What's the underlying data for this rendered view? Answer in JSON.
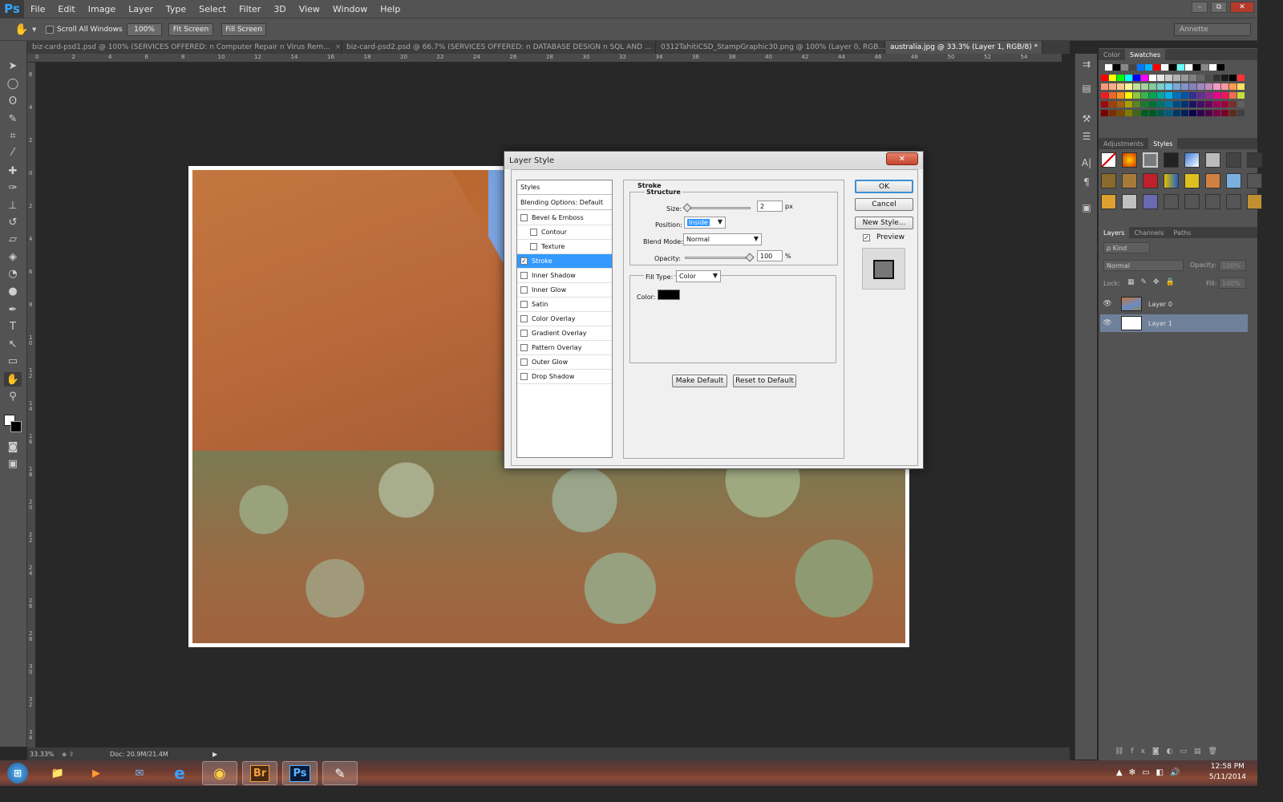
{
  "app": {
    "logo": "Ps",
    "menu": [
      "File",
      "Edit",
      "Image",
      "Layer",
      "Type",
      "Select",
      "Filter",
      "3D",
      "View",
      "Window",
      "Help"
    ],
    "window_controls": [
      "–",
      "⧉",
      "✕"
    ]
  },
  "options_bar": {
    "scroll_all_windows": "Scroll All Windows",
    "zoom100": "100%",
    "fit_screen": "Fit Screen",
    "fill_screen": "Fill Screen",
    "workspace": "Annette"
  },
  "tabs": [
    {
      "label": "biz-card-psd1.psd @ 100% (SERVICES OFFERED: n    Computer Repair    n Virus Rem..."
    },
    {
      "label": "biz-card-psd2.psd @ 66.7% (SERVICES OFFERED: n    DATABASE DESIGN n SQL AND ..."
    },
    {
      "label": "0312TahitiCSD_StampGraphic30.png @ 100% (Layer 0, RGB..."
    },
    {
      "label": "australia.jpg @ 33.3% (Layer 1, RGB/8) *"
    }
  ],
  "ruler": {
    "h_ticks": [
      "0",
      "2",
      "4",
      "6",
      "8",
      "10",
      "12",
      "14",
      "16",
      "18",
      "20",
      "22",
      "24",
      "26",
      "28",
      "30",
      "32",
      "34",
      "36",
      "38",
      "40",
      "42",
      "44",
      "46",
      "48",
      "50",
      "52",
      "54"
    ],
    "v_ticks": [
      "6",
      "4",
      "2",
      "0",
      "2",
      "4",
      "6",
      "8",
      "1 0",
      "1 2",
      "1 4",
      "1 6",
      "1 8",
      "2 0",
      "2 2",
      "2 4",
      "2 6",
      "2 8",
      "3 0",
      "3 2",
      "3 4",
      "3 6"
    ]
  },
  "status": {
    "zoom": "33.33%",
    "doc": "Doc: 20.9M/21.4M"
  },
  "dialog": {
    "title": "Layer Style",
    "close": "✕",
    "styles_header": "Styles",
    "blending": "Blending Options: Default",
    "items": [
      {
        "label": "Bevel & Emboss",
        "checked": false,
        "indent": false
      },
      {
        "label": "Contour",
        "checked": false,
        "indent": true
      },
      {
        "label": "Texture",
        "checked": false,
        "indent": true
      },
      {
        "label": "Stroke",
        "checked": true,
        "indent": false
      },
      {
        "label": "Inner Shadow",
        "checked": false,
        "indent": false
      },
      {
        "label": "Inner Glow",
        "checked": false,
        "indent": false
      },
      {
        "label": "Satin",
        "checked": false,
        "indent": false
      },
      {
        "label": "Color Overlay",
        "checked": false,
        "indent": false
      },
      {
        "label": "Gradient Overlay",
        "checked": false,
        "indent": false
      },
      {
        "label": "Pattern Overlay",
        "checked": false,
        "indent": false
      },
      {
        "label": "Outer Glow",
        "checked": false,
        "indent": false
      },
      {
        "label": "Drop Shadow",
        "checked": false,
        "indent": false
      }
    ],
    "stroke_title": "Stroke",
    "structure_title": "Structure",
    "size_label": "Size:",
    "size_value": "2",
    "size_unit": "px",
    "position_label": "Position:",
    "position_value": "Inside",
    "blend_label": "Blend Mode:",
    "blend_value": "Normal",
    "opacity_label": "Opacity:",
    "opacity_value": "100",
    "opacity_unit": "%",
    "filltype_label": "Fill Type:",
    "filltype_value": "Color",
    "color_label": "Color:",
    "color_value": "#000000",
    "make_default": "Make Default",
    "reset_default": "Reset to Default",
    "ok": "OK",
    "cancel": "Cancel",
    "new_style": "New Style...",
    "preview": "Preview"
  },
  "panels": {
    "color_tab": "Color",
    "swatches_tab": "Swatches",
    "adjustments_tab": "Adjustments",
    "styles_tab": "Styles",
    "layers_tab": "Layers",
    "channels_tab": "Channels",
    "paths_tab": "Paths",
    "kind": "ρ Kind",
    "blend": "Normal",
    "opacity_label": "Opacity:",
    "opacity": "100%",
    "lock_label": "Lock:",
    "fill_label": "Fill:",
    "fill": "100%",
    "layers": [
      {
        "name": "Layer 0",
        "selected": false
      },
      {
        "name": "Layer 1",
        "selected": true
      }
    ]
  },
  "taskbar": {
    "time": "12:58 PM",
    "date": "5/11/2014",
    "apps": [
      "⊞",
      "📁",
      "▶",
      "✉",
      "e",
      "◉",
      "Br",
      "Ps",
      "✎"
    ]
  }
}
